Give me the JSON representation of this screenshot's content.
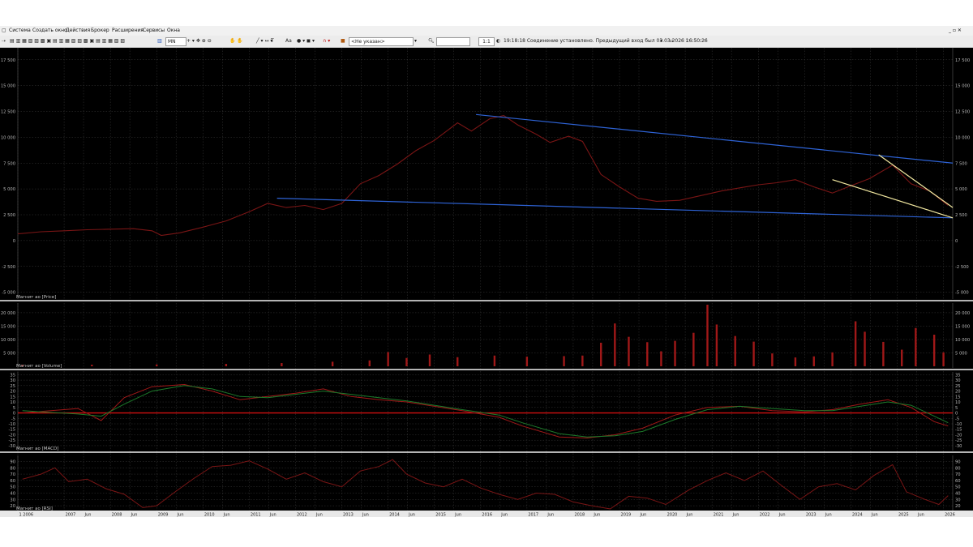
{
  "menu": [
    "Система",
    "Создать окно",
    "Действия",
    "Брокер",
    "Расширения",
    "Сервисы",
    "Окна"
  ],
  "toolbar": {
    "timeframe": "MN",
    "text_tool": "T",
    "font_tool": "Aa",
    "instrument_placeholder": "<Не указан>",
    "ratio": "1:1",
    "status": "19:18:18 Соединение установлено. Предыдущий вход был 03.03.2026 16:50:26"
  },
  "panes": {
    "price": {
      "label": "Магнит ао [Price]",
      "ticks": [
        "17 500",
        "15 000",
        "12 500",
        "10 000",
        "7 500",
        "5 000",
        "2 500",
        "0",
        "-2 500",
        "-5 000"
      ]
    },
    "volume": {
      "label": "Магнит ао [Volume]",
      "ticks": [
        "20 000",
        "15 000",
        "10 000",
        "5 000"
      ]
    },
    "macd": {
      "label": "Магнит ао [MACD]",
      "ticks": [
        "35",
        "30",
        "25",
        "20",
        "15",
        "10",
        "5",
        "0",
        "-5",
        "-10",
        "-15",
        "-20",
        "-25",
        "-30"
      ]
    },
    "rsi": {
      "label": "Магнит ао [RSI]",
      "ticks": [
        "90",
        "80",
        "70",
        "60",
        "50",
        "40",
        "30",
        "20"
      ]
    }
  },
  "time_axis": [
    "1 2006",
    "2007",
    "Jun",
    "2008",
    "Jun",
    "2009",
    "Jun",
    "2010",
    "Jun",
    "2011",
    "Jun",
    "2012",
    "Jun",
    "2013",
    "Jun",
    "2014",
    "Jun",
    "2015",
    "Jun",
    "2016",
    "Jun",
    "2017",
    "Jun",
    "2018",
    "Jun",
    "2019",
    "Jun",
    "2020",
    "Jun",
    "2021",
    "Jun",
    "2022",
    "Jun",
    "2023",
    "Jun",
    "2024",
    "Jun",
    "2025",
    "Jun",
    "2026"
  ],
  "colors": {
    "background": "#000000",
    "grid": "#3a3a3a",
    "price_line": "#7a1515",
    "volume_bar": "#a01818",
    "macd_line": "#a01818",
    "signal_line": "#1c7a2a",
    "trendline": "#2e63d6",
    "wedge": "#f2e8a0",
    "zero_line": "#d01010",
    "axis_text": "#b8b8b8"
  },
  "chart_data": [
    {
      "type": "line",
      "x_range": [
        2006.0,
        2026.2
      ],
      "ylim": [
        -5500,
        18500
      ],
      "series": [
        {
          "points": [
            [
              2006.0,
              650
            ],
            [
              2006.5,
              850
            ],
            [
              2007.0,
              950
            ],
            [
              2007.5,
              1050
            ],
            [
              2008.0,
              1100
            ],
            [
              2008.5,
              1150
            ],
            [
              2008.9,
              950
            ],
            [
              2009.1,
              500
            ],
            [
              2009.5,
              750
            ],
            [
              2010.0,
              1300
            ],
            [
              2010.5,
              1900
            ],
            [
              2011.0,
              2800
            ],
            [
              2011.4,
              3600
            ],
            [
              2011.8,
              3200
            ],
            [
              2012.2,
              3400
            ],
            [
              2012.6,
              3000
            ],
            [
              2013.0,
              3600
            ],
            [
              2013.4,
              5500
            ],
            [
              2013.8,
              6300
            ],
            [
              2014.2,
              7400
            ],
            [
              2014.6,
              8700
            ],
            [
              2015.0,
              9700
            ],
            [
              2015.5,
              11400
            ],
            [
              2015.8,
              10600
            ],
            [
              2016.2,
              11800
            ],
            [
              2016.5,
              12100
            ],
            [
              2016.8,
              11200
            ],
            [
              2017.2,
              10300
            ],
            [
              2017.5,
              9500
            ],
            [
              2017.9,
              10100
            ],
            [
              2018.2,
              9600
            ],
            [
              2018.6,
              6400
            ],
            [
              2019.0,
              5200
            ],
            [
              2019.4,
              4100
            ],
            [
              2019.8,
              3800
            ],
            [
              2020.3,
              3900
            ],
            [
              2020.8,
              4400
            ],
            [
              2021.2,
              4800
            ],
            [
              2021.6,
              5100
            ],
            [
              2022.0,
              5400
            ],
            [
              2022.4,
              5600
            ],
            [
              2022.8,
              5900
            ],
            [
              2023.2,
              5200
            ],
            [
              2023.6,
              4600
            ],
            [
              2024.0,
              5300
            ],
            [
              2024.4,
              6000
            ],
            [
              2024.9,
              7300
            ],
            [
              2025.3,
              5500
            ],
            [
              2025.7,
              4800
            ],
            [
              2026.1,
              3400
            ]
          ]
        }
      ],
      "trendlines": [
        {
          "from": [
            2011.6,
            4100
          ],
          "to": [
            2026.2,
            2200
          ]
        },
        {
          "from": [
            2015.9,
            12200
          ],
          "to": [
            2026.2,
            7500
          ]
        },
        {
          "from": [
            2023.6,
            5900
          ],
          "to": [
            2026.2,
            2200
          ]
        },
        {
          "from": [
            2024.6,
            8300
          ],
          "to": [
            2026.2,
            3200
          ]
        }
      ]
    },
    {
      "type": "bar",
      "ylim": [
        0,
        23000
      ],
      "bars": [
        [
          2006.1,
          500
        ],
        [
          2007.6,
          600
        ],
        [
          2009.0,
          700
        ],
        [
          2010.5,
          900
        ],
        [
          2011.7,
          1200
        ],
        [
          2012.8,
          1700
        ],
        [
          2013.6,
          2200
        ],
        [
          2014.0,
          5300
        ],
        [
          2014.4,
          3100
        ],
        [
          2014.9,
          4400
        ],
        [
          2015.5,
          3400
        ],
        [
          2016.3,
          4000
        ],
        [
          2017.0,
          3600
        ],
        [
          2017.8,
          3800
        ],
        [
          2018.2,
          4000
        ],
        [
          2018.6,
          8800
        ],
        [
          2018.9,
          16000
        ],
        [
          2019.2,
          11000
        ],
        [
          2019.6,
          9000
        ],
        [
          2019.9,
          5600
        ],
        [
          2020.2,
          9500
        ],
        [
          2020.6,
          12500
        ],
        [
          2020.9,
          23000
        ],
        [
          2021.1,
          15600
        ],
        [
          2021.5,
          11300
        ],
        [
          2021.9,
          9200
        ],
        [
          2022.3,
          4800
        ],
        [
          2022.8,
          3300
        ],
        [
          2023.2,
          3700
        ],
        [
          2023.6,
          5200
        ],
        [
          2024.1,
          16800
        ],
        [
          2024.3,
          12900
        ],
        [
          2024.7,
          9100
        ],
        [
          2025.1,
          6200
        ],
        [
          2025.4,
          14300
        ],
        [
          2025.8,
          11800
        ],
        [
          2026.0,
          5200
        ]
      ]
    },
    {
      "type": "line",
      "ylim": [
        -33,
        36
      ],
      "series": [
        {
          "points": [
            [
              2006.1,
              0
            ],
            [
              2007.3,
              4
            ],
            [
              2007.8,
              -7
            ],
            [
              2008.3,
              14
            ],
            [
              2008.9,
              24
            ],
            [
              2009.6,
              26
            ],
            [
              2010.2,
              20
            ],
            [
              2010.8,
              12
            ],
            [
              2011.4,
              15
            ],
            [
              2012.0,
              18
            ],
            [
              2012.6,
              22
            ],
            [
              2013.2,
              15
            ],
            [
              2013.8,
              12
            ],
            [
              2014.4,
              10
            ],
            [
              2015.0,
              6
            ],
            [
              2015.6,
              2
            ],
            [
              2016.4,
              -4
            ],
            [
              2016.9,
              -12
            ],
            [
              2017.7,
              -22
            ],
            [
              2018.3,
              -23
            ],
            [
              2018.9,
              -20
            ],
            [
              2019.5,
              -14
            ],
            [
              2020.2,
              -2
            ],
            [
              2020.9,
              5
            ],
            [
              2021.6,
              6
            ],
            [
              2022.3,
              2
            ],
            [
              2023.0,
              1
            ],
            [
              2023.6,
              3
            ],
            [
              2024.2,
              8
            ],
            [
              2024.8,
              12
            ],
            [
              2025.3,
              5
            ],
            [
              2025.8,
              -8
            ],
            [
              2026.1,
              -12
            ]
          ]
        },
        {
          "points": [
            [
              2006.1,
              2
            ],
            [
              2007.3,
              -1
            ],
            [
              2007.8,
              -3
            ],
            [
              2008.3,
              8
            ],
            [
              2008.9,
              20
            ],
            [
              2009.6,
              25
            ],
            [
              2010.2,
              22
            ],
            [
              2010.8,
              15
            ],
            [
              2011.4,
              14
            ],
            [
              2012.0,
              17
            ],
            [
              2012.6,
              20
            ],
            [
              2013.2,
              17
            ],
            [
              2013.8,
              14
            ],
            [
              2014.4,
              11
            ],
            [
              2015.0,
              7
            ],
            [
              2015.6,
              3
            ],
            [
              2016.4,
              -2
            ],
            [
              2016.9,
              -9
            ],
            [
              2017.7,
              -19
            ],
            [
              2018.3,
              -22
            ],
            [
              2018.9,
              -21
            ],
            [
              2019.5,
              -17
            ],
            [
              2020.2,
              -6
            ],
            [
              2020.9,
              3
            ],
            [
              2021.6,
              6
            ],
            [
              2022.3,
              4
            ],
            [
              2023.0,
              2
            ],
            [
              2023.6,
              2
            ],
            [
              2024.2,
              6
            ],
            [
              2024.8,
              10
            ],
            [
              2025.3,
              7
            ],
            [
              2025.8,
              -3
            ],
            [
              2026.1,
              -9
            ]
          ]
        }
      ]
    },
    {
      "type": "line",
      "ylim": [
        15,
        97
      ],
      "series": [
        {
          "points": [
            [
              2006.1,
              62
            ],
            [
              2006.5,
              70
            ],
            [
              2006.8,
              80
            ],
            [
              2007.1,
              58
            ],
            [
              2007.5,
              62
            ],
            [
              2007.9,
              47
            ],
            [
              2008.3,
              38
            ],
            [
              2008.7,
              17
            ],
            [
              2009.0,
              20
            ],
            [
              2009.4,
              42
            ],
            [
              2009.8,
              63
            ],
            [
              2010.2,
              82
            ],
            [
              2010.6,
              84
            ],
            [
              2011.0,
              91
            ],
            [
              2011.4,
              78
            ],
            [
              2011.8,
              62
            ],
            [
              2012.2,
              72
            ],
            [
              2012.6,
              58
            ],
            [
              2013.0,
              50
            ],
            [
              2013.4,
              75
            ],
            [
              2013.8,
              82
            ],
            [
              2014.1,
              93
            ],
            [
              2014.4,
              70
            ],
            [
              2014.8,
              56
            ],
            [
              2015.2,
              50
            ],
            [
              2015.6,
              62
            ],
            [
              2016.0,
              48
            ],
            [
              2016.4,
              38
            ],
            [
              2016.8,
              30
            ],
            [
              2017.2,
              40
            ],
            [
              2017.6,
              38
            ],
            [
              2018.0,
              26
            ],
            [
              2018.4,
              20
            ],
            [
              2018.8,
              15
            ],
            [
              2019.2,
              35
            ],
            [
              2019.6,
              32
            ],
            [
              2020.0,
              22
            ],
            [
              2020.5,
              45
            ],
            [
              2020.9,
              60
            ],
            [
              2021.3,
              72
            ],
            [
              2021.7,
              60
            ],
            [
              2022.1,
              75
            ],
            [
              2022.5,
              52
            ],
            [
              2022.9,
              30
            ],
            [
              2023.3,
              50
            ],
            [
              2023.7,
              55
            ],
            [
              2024.1,
              45
            ],
            [
              2024.5,
              68
            ],
            [
              2024.9,
              85
            ],
            [
              2025.2,
              42
            ],
            [
              2025.6,
              30
            ],
            [
              2025.9,
              22
            ],
            [
              2026.1,
              36
            ]
          ]
        }
      ]
    }
  ]
}
